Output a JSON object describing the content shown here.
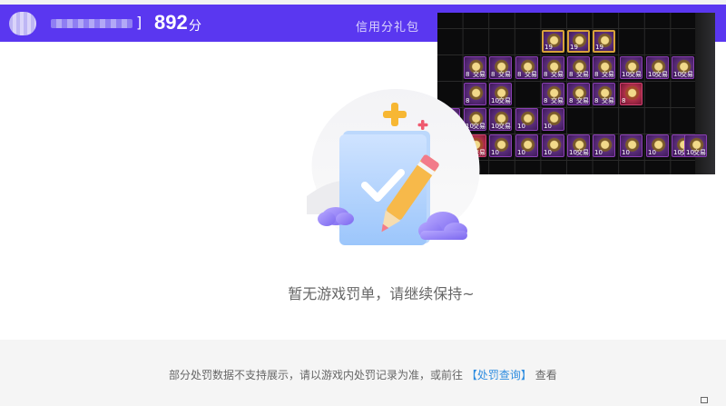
{
  "header": {
    "bracket": "]",
    "score": "892",
    "score_unit": "分",
    "nav_link": "信用分礼包"
  },
  "game_overlay": {
    "slots": [
      {
        "num": "19",
        "tag": ""
      },
      {
        "num": "19",
        "tag": ""
      },
      {
        "num": "19",
        "tag": ""
      },
      {
        "num": "8",
        "tag": "交易"
      },
      {
        "num": "8",
        "tag": "交易"
      },
      {
        "num": "8",
        "tag": "交易"
      },
      {
        "num": "8",
        "tag": "交易"
      },
      {
        "num": "8",
        "tag": "交易"
      },
      {
        "num": "8",
        "tag": "交易"
      },
      {
        "num": "10",
        "tag": "交易"
      },
      {
        "num": "10",
        "tag": "交易"
      },
      {
        "num": "10",
        "tag": "交易"
      },
      {
        "num": "8",
        "tag": ""
      },
      {
        "num": "10",
        "tag": "交易"
      },
      {
        "num": "8",
        "tag": "交易"
      },
      {
        "num": "8",
        "tag": "交易"
      },
      {
        "num": "8",
        "tag": "交易"
      },
      {
        "num": "8",
        "tag": ""
      },
      {
        "num": "10",
        "tag": ""
      },
      {
        "num": "10",
        "tag": "交易"
      },
      {
        "num": "10",
        "tag": "交易"
      },
      {
        "num": "10",
        "tag": ""
      },
      {
        "num": "10",
        "tag": ""
      },
      {
        "num": "11",
        "tag": ""
      },
      {
        "num": "11",
        "tag": "交易"
      },
      {
        "num": "10",
        "tag": ""
      },
      {
        "num": "10",
        "tag": ""
      },
      {
        "num": "10",
        "tag": ""
      },
      {
        "num": "10",
        "tag": "交易"
      },
      {
        "num": "10",
        "tag": ""
      },
      {
        "num": "10",
        "tag": ""
      },
      {
        "num": "10",
        "tag": ""
      },
      {
        "num": "10",
        "tag": "交易"
      },
      {
        "num": "10",
        "tag": "交易"
      }
    ]
  },
  "empty_state": {
    "message": "暂无游戏罚单，请继续保持~"
  },
  "footer": {
    "note_prefix": "部分处罚数据不支持展示，请以游戏内处罚记录为准，或前往",
    "link_label": "【处罚查询】",
    "note_suffix": "查看"
  },
  "icons": {
    "plus_color": "#f7b733",
    "accent_plus_color": "#ef5a6f",
    "cloud_color": "#8f7df3",
    "checkmark_color": "#ffffff",
    "header_bg": "#5a37f0"
  }
}
